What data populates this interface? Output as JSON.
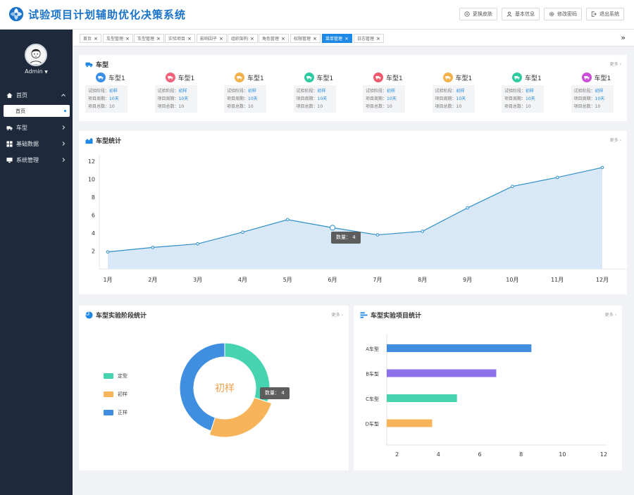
{
  "header": {
    "title": "试验项目计划辅助优化决策系统",
    "buttons": [
      {
        "label": "更换皮肤",
        "icon": "skin-icon"
      },
      {
        "label": "基本信息",
        "icon": "user-icon"
      },
      {
        "label": "修改密码",
        "icon": "gear-icon"
      },
      {
        "label": "退出系统",
        "icon": "logout-icon"
      }
    ]
  },
  "sidebar": {
    "user": "Admin",
    "menu": [
      {
        "label": "首页",
        "icon": "home-icon"
      },
      {
        "label": "车型",
        "icon": "truck-icon"
      },
      {
        "label": "基础数据",
        "icon": "grid-icon"
      },
      {
        "label": "系统管理",
        "icon": "monitor-icon"
      }
    ],
    "submenu_active": "首页"
  },
  "tabs": [
    {
      "label": "首页",
      "active": false
    },
    {
      "label": "车型管理",
      "active": false
    },
    {
      "label": "车型管理",
      "active": false
    },
    {
      "label": "实验项目",
      "active": false
    },
    {
      "label": "影响因子",
      "active": false
    },
    {
      "label": "组织架构",
      "active": false
    },
    {
      "label": "角色管理",
      "active": false
    },
    {
      "label": "权限管理",
      "active": false
    },
    {
      "label": "菜单管理",
      "active": true
    },
    {
      "label": "日志管理",
      "active": false
    }
  ],
  "vehicles": {
    "title": "车型",
    "more": "更多",
    "stage_label": "试验阶段：",
    "cycle_label": "项目周期：",
    "total_label": "项目总数：",
    "items": [
      {
        "name": "车型1",
        "stage": "初样",
        "cycle": "10天",
        "total": "10",
        "color": "#3a8ee6"
      },
      {
        "name": "车型1",
        "stage": "初样",
        "cycle": "10天",
        "total": "10",
        "color": "#f0637b"
      },
      {
        "name": "车型1",
        "stage": "初样",
        "cycle": "10天",
        "total": "10",
        "color": "#f6b14a"
      },
      {
        "name": "车型1",
        "stage": "初样",
        "cycle": "10天",
        "total": "10",
        "color": "#2fcba0"
      },
      {
        "name": "车型1",
        "stage": "初样",
        "cycle": "10天",
        "total": "10",
        "color": "#ee5a6c"
      },
      {
        "name": "车型1",
        "stage": "初样",
        "cycle": "10天",
        "total": "10",
        "color": "#f6b14a"
      },
      {
        "name": "车型1",
        "stage": "初样",
        "cycle": "10天",
        "total": "10",
        "color": "#2fcba0"
      },
      {
        "name": "车型1",
        "stage": "初样",
        "cycle": "10天",
        "total": "10",
        "color": "#c94fd6"
      }
    ]
  },
  "line_chart": {
    "title": "车型统计",
    "more": "更多",
    "tooltip": "数量：  4"
  },
  "donut_chart": {
    "title": "车型实验阶段统计",
    "more": "更多",
    "center_label": "初样",
    "tooltip": "数量：  4"
  },
  "bar_chart": {
    "title": "车型实验项目统计",
    "more": "更多"
  },
  "chart_data": [
    {
      "type": "area",
      "title": "车型统计",
      "x": [
        "1月",
        "2月",
        "3月",
        "4月",
        "5月",
        "6月",
        "7月",
        "8月",
        "9月",
        "10月",
        "11月",
        "12月"
      ],
      "values": [
        1.9,
        2.4,
        2.8,
        4.1,
        5.5,
        4.6,
        3.8,
        4.2,
        6.8,
        9.2,
        10.2,
        11.3
      ],
      "ylim": [
        0,
        12
      ],
      "yticks": [
        2,
        4,
        6,
        8,
        10,
        12
      ],
      "color": "#2f8fc9",
      "fill": "#d9e8f7"
    },
    {
      "type": "pie",
      "title": "车型实验阶段统计",
      "labels": [
        "定型",
        "初样",
        "正样"
      ],
      "values": [
        30,
        25,
        45
      ],
      "colors": [
        "#46d4b0",
        "#f7b45a",
        "#3f8ee0"
      ]
    },
    {
      "type": "bar",
      "title": "车型实验项目统计",
      "categories": [
        "A车型",
        "B车型",
        "C车型",
        "D车型"
      ],
      "values": [
        8.5,
        6.8,
        4.9,
        3.7
      ],
      "colors": [
        "#3f8ee0",
        "#8b72ea",
        "#46d4b0",
        "#f7b45a"
      ],
      "xticks": [
        2,
        4,
        6,
        8,
        10,
        12
      ]
    }
  ]
}
